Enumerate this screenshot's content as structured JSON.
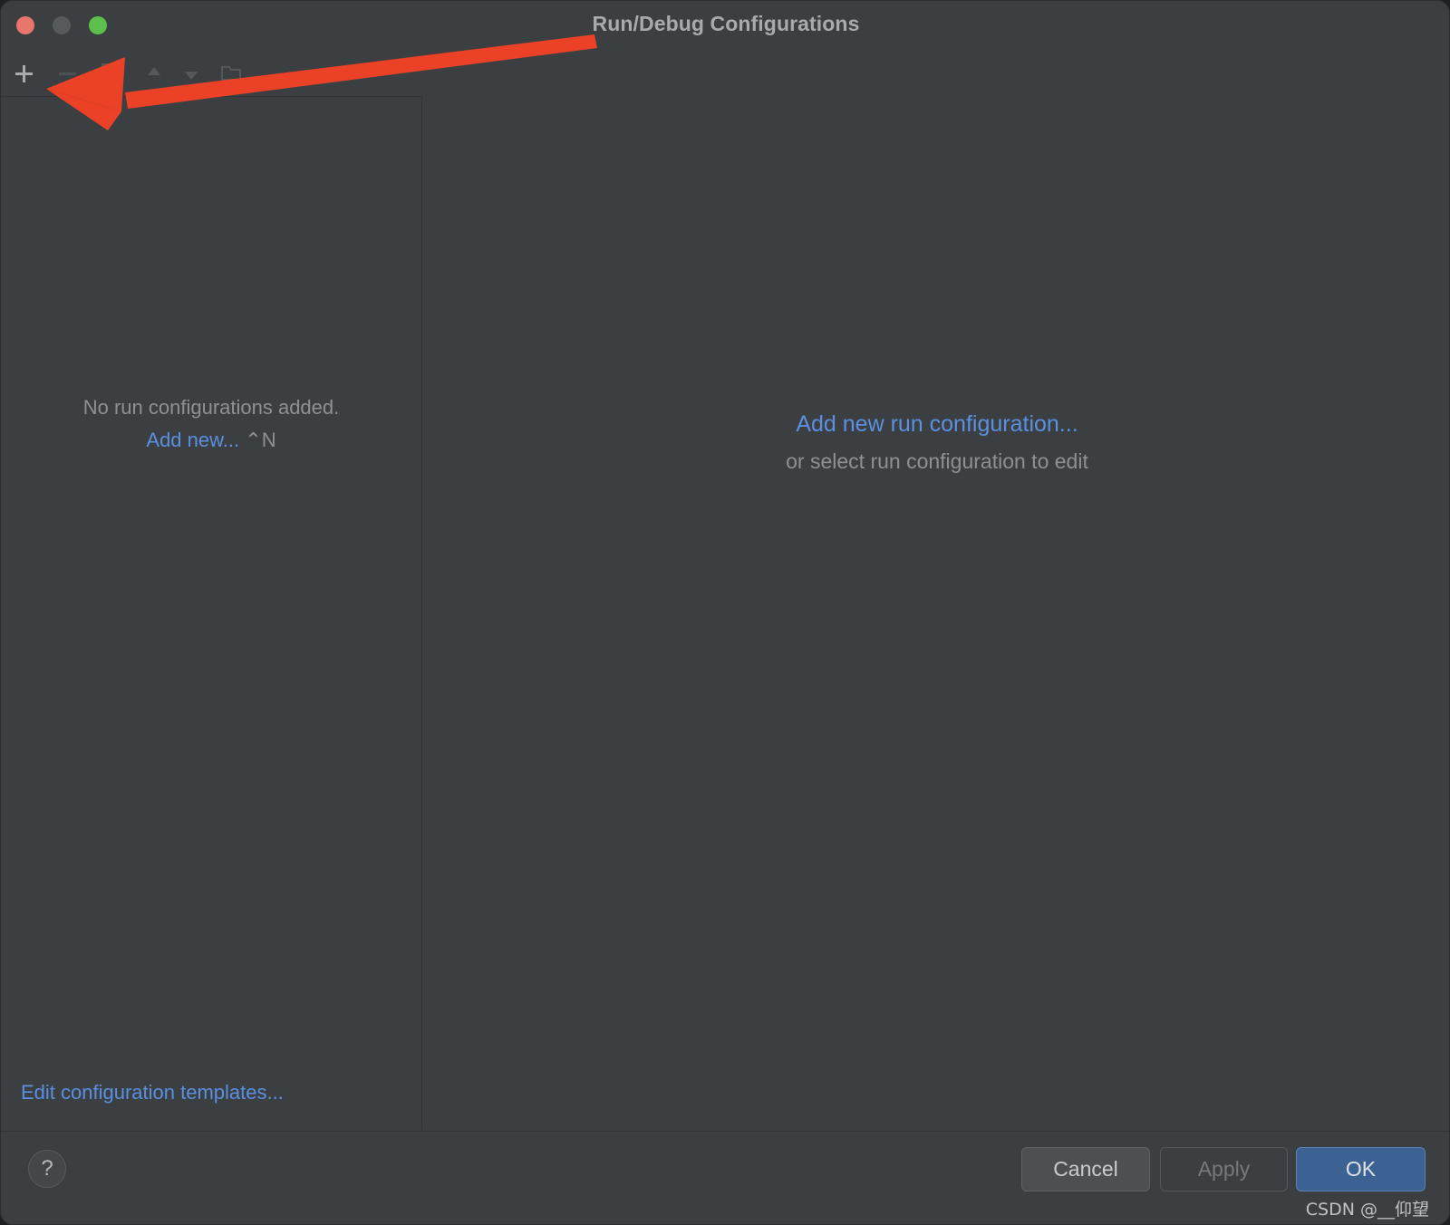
{
  "window": {
    "title": "Run/Debug Configurations",
    "traffic_lights": [
      {
        "name": "close",
        "color": "#e8766b"
      },
      {
        "name": "minimize",
        "color": "#57595b"
      },
      {
        "name": "maximize",
        "color": "#5cc14c"
      }
    ]
  },
  "toolbar": {
    "add_label": "+",
    "icons": [
      "add-icon",
      "remove-icon",
      "copy-configuration-icon",
      "move-up-icon",
      "move-down-icon",
      "new-folder-icon"
    ]
  },
  "left_panel": {
    "empty_message": "No run configurations added.",
    "add_new_link": "Add new...",
    "add_new_shortcut": "⌃N",
    "edit_templates_link": "Edit configuration templates..."
  },
  "right_panel": {
    "add_new_link": "Add new run configuration...",
    "hint": "or select run configuration to edit"
  },
  "bottom_bar": {
    "help_label": "?",
    "cancel_label": "Cancel",
    "apply_label": "Apply",
    "ok_label": "OK"
  },
  "annotation": {
    "arrow_color": "#eb4127",
    "description": "red-arrow-pointing-to-add-button"
  },
  "watermark": {
    "text": "CSDN @__仰望"
  },
  "colors": {
    "window_bg": "#3c3f41",
    "link_blue": "#5b8fe0",
    "muted_text": "#8d9194",
    "title_text": "#a8abad",
    "ok_button_bg": "#3b6292",
    "accent_red": "#eb4127"
  }
}
